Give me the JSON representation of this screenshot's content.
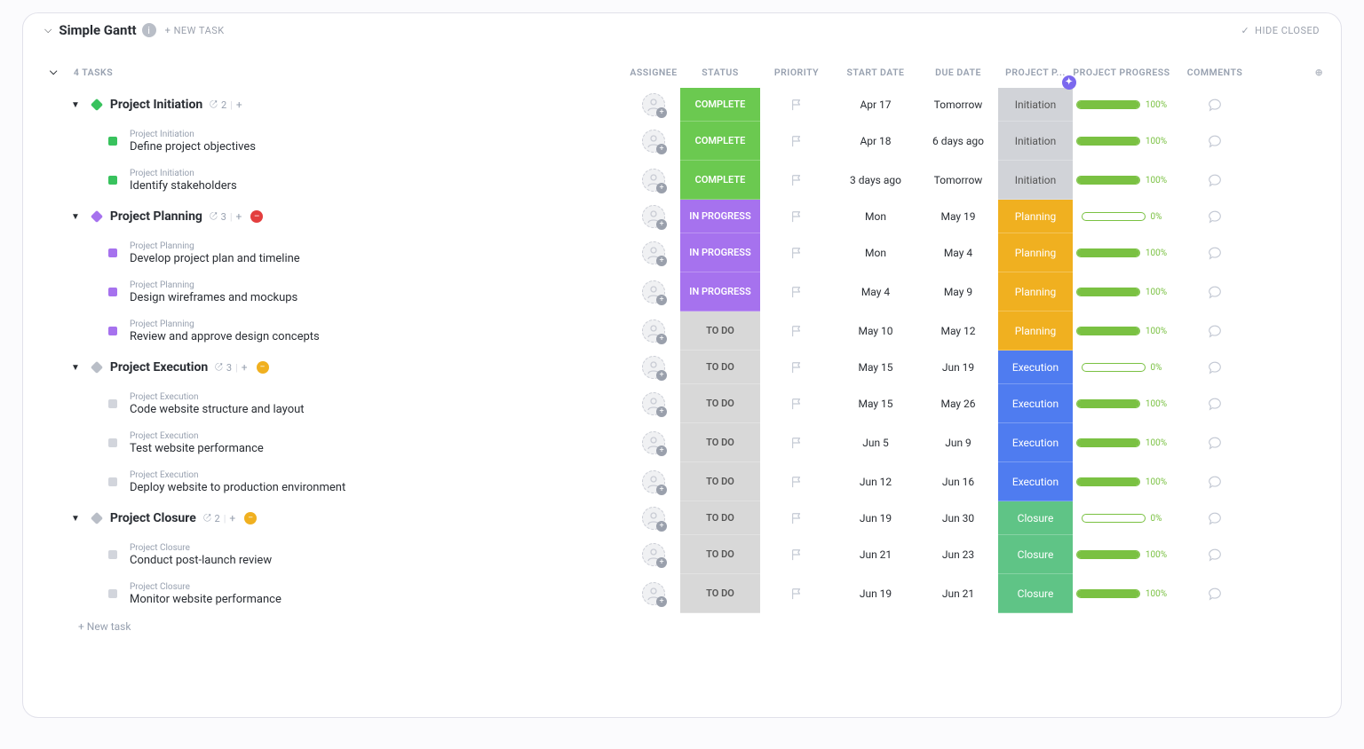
{
  "header": {
    "title": "Simple Gantt",
    "new_task": "+ NEW TASK",
    "hide_closed": "HIDE CLOSED",
    "task_count_label": "4 TASKS"
  },
  "columns": {
    "assignee": "ASSIGNEE",
    "status": "STATUS",
    "priority": "PRIORITY",
    "start": "START DATE",
    "due": "DUE DATE",
    "phase": "PROJECT P...",
    "progress": "PROJECT PROGRESS",
    "comments": "COMMENTS"
  },
  "status_colors": {
    "COMPLETE": "#6bc950",
    "IN PROGRESS": "#a672ee",
    "TO DO": "#d8d8d8"
  },
  "phase_colors": {
    "Initiation": "#d1d3d8",
    "Planning": "#f0b020",
    "Execution": "#4f7cf0",
    "Closure": "#5fc486"
  },
  "group_colors": {
    "Project Initiation": "#38c25d",
    "Project Planning": "#a672ee",
    "Project Execution": "#b9bec7",
    "Project Closure": "#b9bec7"
  },
  "square_colors": {
    "Project Initiation": "#38c25d",
    "Project Planning": "#a672ee",
    "Project Execution": "#d2d5dc",
    "Project Closure": "#d2d5dc"
  },
  "groups": [
    {
      "name": "Project Initiation",
      "count": 2,
      "badge": "",
      "status": "COMPLETE",
      "start": "Apr 17",
      "due": "Tomorrow",
      "phase": "Initiation",
      "progress": 100,
      "tasks": [
        {
          "name": "Define project objectives",
          "status": "COMPLETE",
          "start": "Apr 18",
          "due": "6 days ago",
          "phase": "Initiation",
          "progress": 100
        },
        {
          "name": "Identify stakeholders",
          "status": "COMPLETE",
          "start": "3 days ago",
          "due": "Tomorrow",
          "phase": "Initiation",
          "progress": 100
        }
      ]
    },
    {
      "name": "Project Planning",
      "count": 3,
      "badge": "minus",
      "status": "IN PROGRESS",
      "start": "Mon",
      "due": "May 19",
      "phase": "Planning",
      "progress": 0,
      "tasks": [
        {
          "name": "Develop project plan and timeline",
          "status": "IN PROGRESS",
          "start": "Mon",
          "due": "May 4",
          "phase": "Planning",
          "progress": 100
        },
        {
          "name": "Design wireframes and mockups",
          "status": "IN PROGRESS",
          "start": "May 4",
          "due": "May 9",
          "phase": "Planning",
          "progress": 100
        },
        {
          "name": "Review and approve design concepts",
          "status": "TO DO",
          "start": "May 10",
          "due": "May 12",
          "phase": "Planning",
          "progress": 100
        }
      ]
    },
    {
      "name": "Project Execution",
      "count": 3,
      "badge": "warn",
      "status": "TO DO",
      "start": "May 15",
      "due": "Jun 19",
      "phase": "Execution",
      "progress": 0,
      "tasks": [
        {
          "name": "Code website structure and layout",
          "status": "TO DO",
          "start": "May 15",
          "due": "May 26",
          "phase": "Execution",
          "progress": 100
        },
        {
          "name": "Test website performance",
          "status": "TO DO",
          "start": "Jun 5",
          "due": "Jun 9",
          "phase": "Execution",
          "progress": 100
        },
        {
          "name": "Deploy website to production environment",
          "status": "TO DO",
          "start": "Jun 12",
          "due": "Jun 16",
          "phase": "Execution",
          "progress": 100
        }
      ]
    },
    {
      "name": "Project Closure",
      "count": 2,
      "badge": "warn",
      "status": "TO DO",
      "start": "Jun 19",
      "due": "Jun 30",
      "phase": "Closure",
      "progress": 0,
      "tasks": [
        {
          "name": "Conduct post-launch review",
          "status": "TO DO",
          "start": "Jun 21",
          "due": "Jun 23",
          "phase": "Closure",
          "progress": 100
        },
        {
          "name": "Monitor website performance",
          "status": "TO DO",
          "start": "Jun 19",
          "due": "Jun 21",
          "phase": "Closure",
          "progress": 100
        }
      ]
    }
  ],
  "footer": {
    "new_task": "+ New task"
  }
}
